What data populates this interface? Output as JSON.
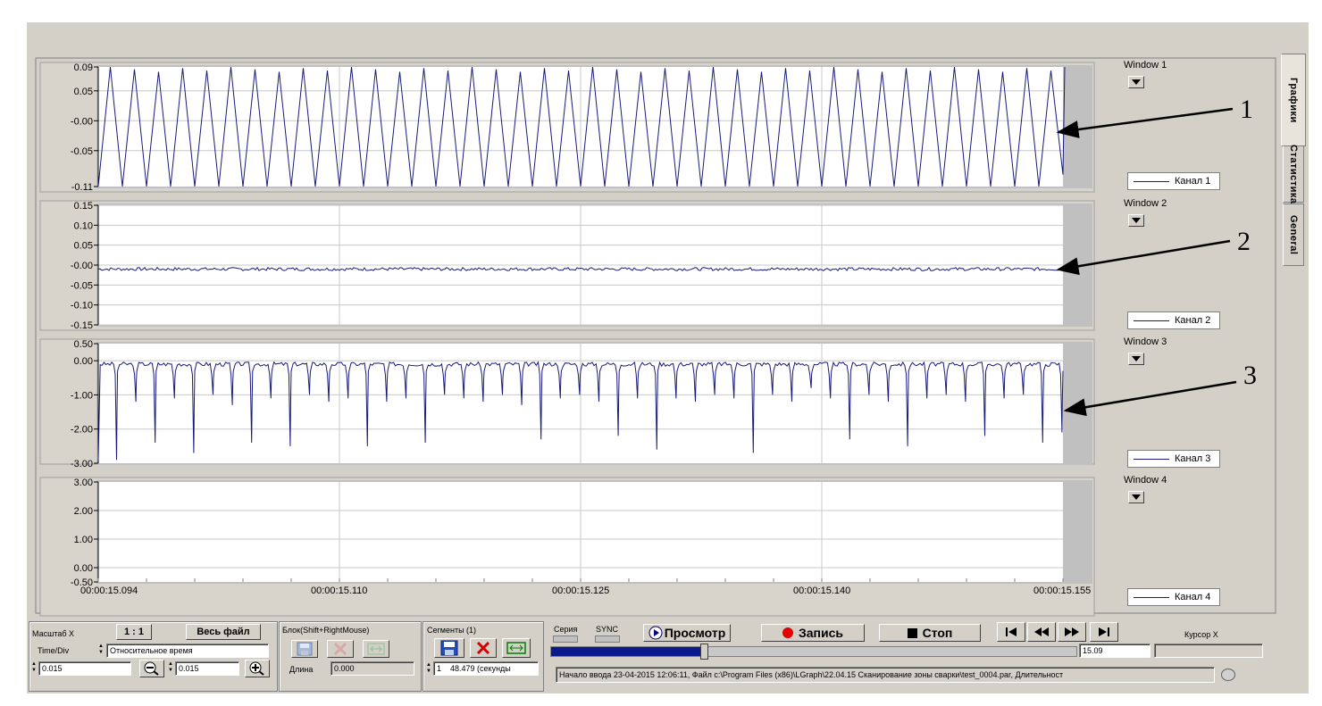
{
  "tabs": [
    "Графики",
    "Статистика",
    "General"
  ],
  "annotations": [
    "1",
    "2",
    "3"
  ],
  "x_axis": {
    "ticks": [
      "00:00:15.094",
      "00:00:15.110",
      "00:00:15.125",
      "00:00:15.140",
      "00:00:15.155"
    ]
  },
  "chart_data": [
    {
      "type": "line",
      "window": "Window 1",
      "legend": "Канал 1",
      "ylim": [
        -0.11,
        0.09
      ],
      "y_ticks": [
        "0.09",
        "0.05",
        "-0.00",
        "-0.05",
        "-0.11"
      ],
      "y_tick_values": [
        0.09,
        0.05,
        0.0,
        -0.05,
        -0.11
      ],
      "pattern": "triangle",
      "cycles": 40,
      "min": -0.11,
      "max": 0.09
    },
    {
      "type": "line",
      "window": "Window 2",
      "legend": "Канал 2",
      "ylim": [
        -0.15,
        0.15
      ],
      "y_ticks": [
        "0.15",
        "0.10",
        "0.05",
        "-0.00",
        "-0.05",
        "-0.10",
        "-0.15"
      ],
      "y_tick_values": [
        0.15,
        0.1,
        0.05,
        0.0,
        -0.05,
        -0.1,
        -0.15
      ],
      "pattern": "noise",
      "mean": -0.01,
      "amplitude": 0.004
    },
    {
      "type": "line",
      "window": "Window 3",
      "legend": "Канал 3",
      "ylim": [
        -3.0,
        0.5
      ],
      "y_ticks": [
        "0.50",
        "0.00",
        "-1.00",
        "-2.00",
        "-3.00"
      ],
      "y_tick_values": [
        0.5,
        0.0,
        -1.0,
        -2.0,
        -3.0
      ],
      "pattern": "dips",
      "cycles": 50,
      "baseline": -0.1,
      "dip_depths": [
        -2.9,
        -1.2,
        -2.4,
        -1.1,
        -2.7,
        -1.0,
        -1.3,
        -2.4,
        -1.1,
        -2.5,
        -1.0,
        -1.2,
        -1.1,
        -2.5,
        -1.2,
        -1.1,
        -2.4,
        -1.0,
        -1.1,
        -1.2,
        -1.0,
        -1.3,
        -2.3,
        -1.1,
        -1.0,
        -1.2,
        -2.2,
        -1.1,
        -2.6,
        -1.1,
        -1.2,
        -1.0,
        -1.1,
        -2.7,
        -1.0,
        -1.2,
        -0.8,
        -1.1,
        -2.3,
        -1.0,
        -1.2,
        -2.5,
        -1.1,
        -1.0,
        -1.2,
        -2.2,
        -1.1,
        -1.0,
        -2.4,
        -2.1
      ]
    },
    {
      "type": "line",
      "window": "Window 4",
      "legend": "Канал 4",
      "ylim": [
        -0.5,
        3.0
      ],
      "y_ticks": [
        "3.00",
        "2.00",
        "1.00",
        "0.00",
        "-0.50"
      ],
      "y_tick_values": [
        3.0,
        2.0,
        1.0,
        0.0,
        -0.5
      ],
      "pattern": "empty"
    }
  ],
  "bottom": {
    "scale": {
      "title": "Масштаб X",
      "ratio_btn": "1 : 1",
      "whole_file_btn": "Весь файл",
      "time_div_label": "Time/Div",
      "mode_value": "Относительное время",
      "value_left": "0.015",
      "value_right": "0.015"
    },
    "block": {
      "title": "Блок(Shift+RightMouse)",
      "length_label": "Длина",
      "length_value": "0.000"
    },
    "segments": {
      "title": "Сегменты (1)",
      "index": "1",
      "duration": "48.479 (секунды"
    },
    "series_label": "Серия",
    "sync_label": "SYNC",
    "view_btn": "Просмотр",
    "record_btn": "Запись",
    "stop_btn": "Стоп",
    "cursor_label": "Курсор X",
    "position_value": "15.09",
    "progress": 0.29,
    "status": "Начало ввода  23-04-2015 12:06:11, Файл c:\\Program Files (x86)\\LGraph\\22.04.15 Сканирование зоны сварки\\test_0004.par, Длительност",
    "colors": {
      "trace": "#1a1a7a",
      "progress": "#0a1a8a",
      "record": "#e00000"
    }
  }
}
